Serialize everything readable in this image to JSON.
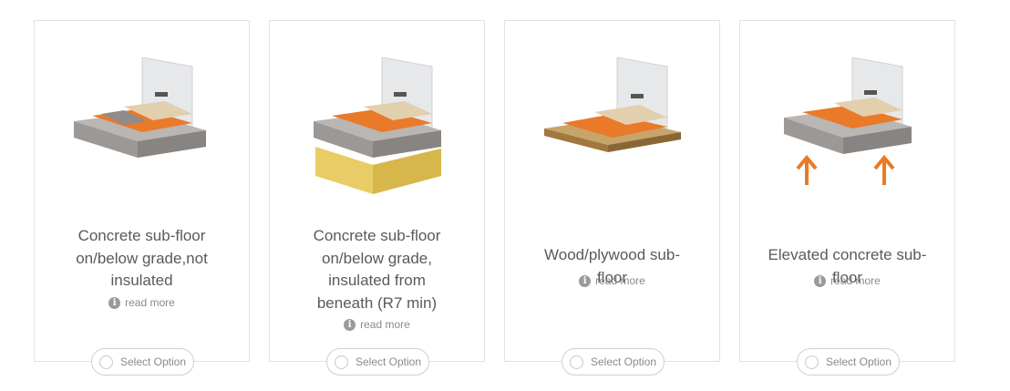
{
  "options": [
    {
      "title_lines": [
        "Concrete sub-floor",
        "on/below grade,not",
        "insulated"
      ],
      "read_more": "read more",
      "select_label": "Select Option"
    },
    {
      "title_lines": [
        "Concrete sub-floor",
        "on/below grade,",
        "insulated from",
        "beneath (R7 min)"
      ],
      "read_more": "read more",
      "select_label": "Select Option"
    },
    {
      "title_lines": [
        "Wood/plywood sub-",
        "floor"
      ],
      "read_more": "read more",
      "select_label": "Select Option"
    },
    {
      "title_lines": [
        "Elevated concrete sub-",
        "floor"
      ],
      "read_more": "read more",
      "select_label": "Select Option"
    }
  ],
  "icons": {
    "info": "i"
  },
  "colors": {
    "accent_orange": "#ea7a24",
    "border": "#e2e2e2",
    "text": "#5a5a5a",
    "muted": "#8a8a8a"
  }
}
